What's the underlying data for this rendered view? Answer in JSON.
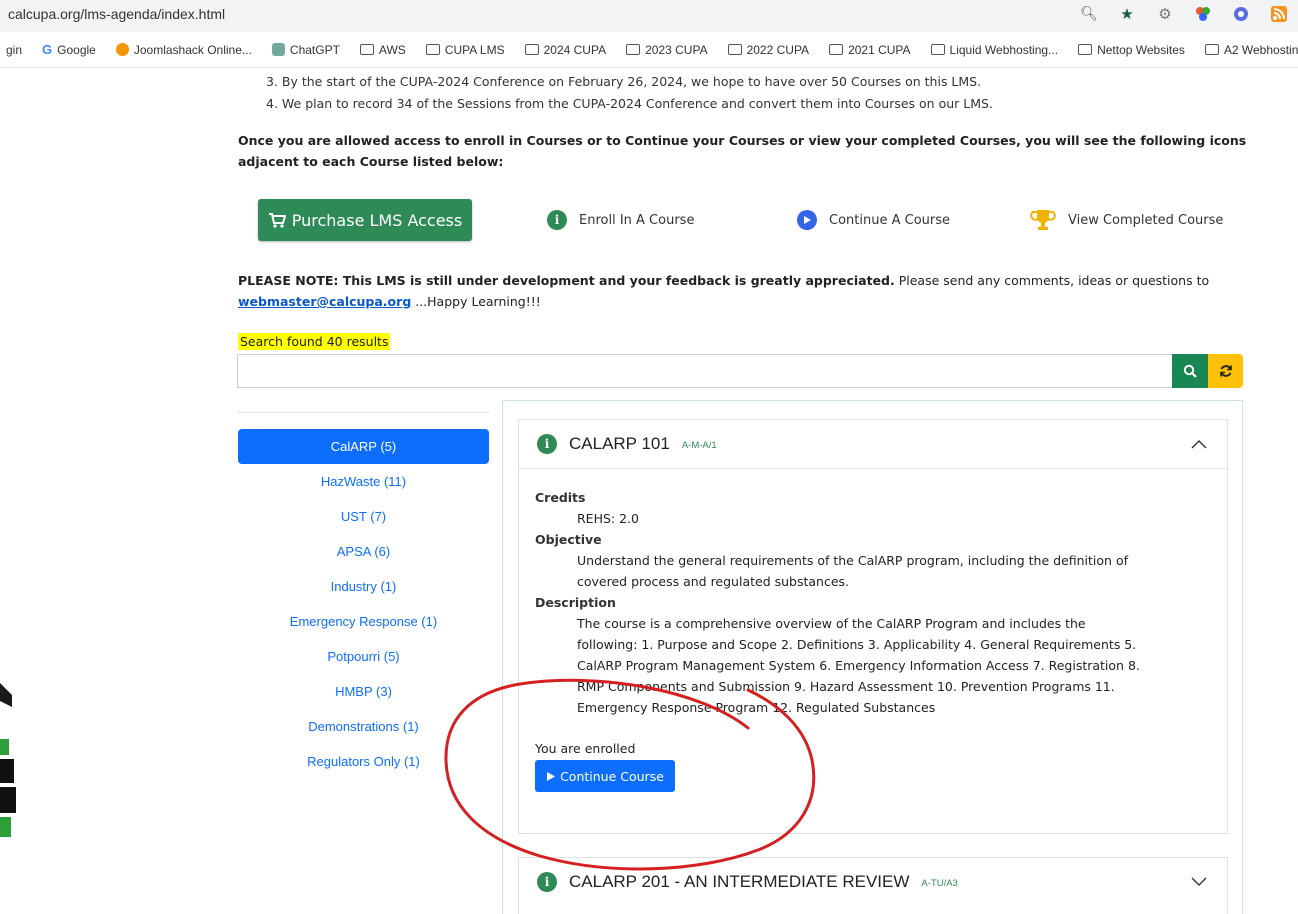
{
  "browser": {
    "url": "calcupa.org/lms-agenda/index.html",
    "bookmarks": [
      "gin",
      "Google",
      "Joomlashack Online...",
      "ChatGPT",
      "AWS",
      "CUPA LMS",
      "2024 CUPA",
      "2023 CUPA",
      "2022 CUPA",
      "2021 CUPA",
      "Liquid Webhosting...",
      "Nettop Websites",
      "A2 Webhostin"
    ]
  },
  "intro": {
    "item3": "3. By the start of the CUPA-2024 Conference on February 26, 2024, we hope to have over 50 Courses on this LMS.",
    "item4": "4. We plan to record 34 of the Sessions from the CUPA-2024 Conference and convert them into Courses on our LMS.",
    "access_note": "Once you are allowed access to enroll in Courses or to Continue your Courses or view your completed Courses, you will see the following icons adjacent to each Course listed below:"
  },
  "legend": {
    "purchase_label": "Purchase LMS Access",
    "enroll_label": "Enroll In A Course",
    "continue_label": "Continue A Course",
    "completed_label": "View Completed Course"
  },
  "notice": {
    "bold": "PLEASE NOTE: This LMS is still under development and your feedback is greatly appreciated.",
    "rest": " Please send any comments, ideas or questions to",
    "email": "webmaster@calcupa.org",
    "tail": " ...Happy Learning!!!"
  },
  "search": {
    "results_text": "Search found 40 results",
    "value": ""
  },
  "categories": [
    {
      "label": "CalARP (5)",
      "active": true
    },
    {
      "label": "HazWaste (11)"
    },
    {
      "label": "UST (7)"
    },
    {
      "label": "APSA (6)"
    },
    {
      "label": "Industry (1)"
    },
    {
      "label": "Emergency Response (1)"
    },
    {
      "label": "Potpourri (5)"
    },
    {
      "label": "HMBP (3)"
    },
    {
      "label": "Demonstrations (1)"
    },
    {
      "label": "Regulators Only (1)"
    }
  ],
  "course1": {
    "title": "CALARP 101",
    "code": "A-M-A/1",
    "credits_label": "Credits",
    "credits_value": "REHS: 2.0",
    "objective_label": "Objective",
    "objective_line1": "Understand the general requirements of the CalARP program, including the definition of",
    "objective_line2": "covered process and regulated substances.",
    "description_label": "Description",
    "description_lines": [
      "The course is a comprehensive overview of the CalARP Program and includes the",
      "following: 1. Purpose and Scope 2. Definitions 3. Applicability 4. General Requirements 5.",
      "CalARP Program Management System 6. Emergency Information Access 7. Registration 8.",
      "RMP Components and Submission 9. Hazard Assessment 10. Prevention Programs 11.",
      "Emergency Response Program 12. Regulated Substances"
    ],
    "enrolled_text": "You are enrolled",
    "continue_label": "Continue Course"
  },
  "course2": {
    "title": "CALARP 201 - AN INTERMEDIATE REVIEW",
    "code": "A-TU/A3"
  },
  "colors": {
    "green": "#2e8b57",
    "blue": "#0d6efd",
    "yellow": "#ffc107",
    "annotation_red": "#d42020"
  }
}
